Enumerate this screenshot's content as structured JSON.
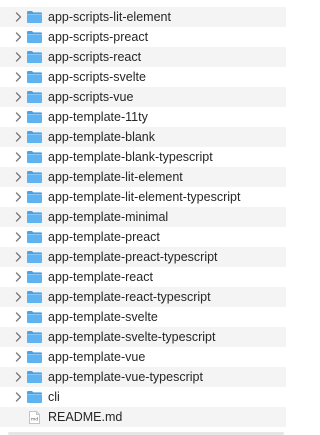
{
  "items": [
    {
      "label": "app-scripts-lit-element",
      "type": "folder"
    },
    {
      "label": "app-scripts-preact",
      "type": "folder"
    },
    {
      "label": "app-scripts-react",
      "type": "folder"
    },
    {
      "label": "app-scripts-svelte",
      "type": "folder"
    },
    {
      "label": "app-scripts-vue",
      "type": "folder"
    },
    {
      "label": "app-template-11ty",
      "type": "folder"
    },
    {
      "label": "app-template-blank",
      "type": "folder"
    },
    {
      "label": "app-template-blank-typescript",
      "type": "folder"
    },
    {
      "label": "app-template-lit-element",
      "type": "folder"
    },
    {
      "label": "app-template-lit-element-typescript",
      "type": "folder"
    },
    {
      "label": "app-template-minimal",
      "type": "folder"
    },
    {
      "label": "app-template-preact",
      "type": "folder"
    },
    {
      "label": "app-template-preact-typescript",
      "type": "folder"
    },
    {
      "label": "app-template-react",
      "type": "folder"
    },
    {
      "label": "app-template-react-typescript",
      "type": "folder"
    },
    {
      "label": "app-template-svelte",
      "type": "folder"
    },
    {
      "label": "app-template-svelte-typescript",
      "type": "folder"
    },
    {
      "label": "app-template-vue",
      "type": "folder"
    },
    {
      "label": "app-template-vue-typescript",
      "type": "folder"
    },
    {
      "label": "cli",
      "type": "folder"
    },
    {
      "label": "README.md",
      "type": "file",
      "icon_text": "md"
    }
  ],
  "colors": {
    "folder": "#5eb3f0",
    "folder_tab": "#4aa2e3",
    "chevron": "#7a7a7a",
    "row_alt": "#f4f4f4"
  },
  "icons": {
    "folder": "folder-icon",
    "chevron": "chevron-right-icon",
    "file": "markdown-file-icon"
  }
}
